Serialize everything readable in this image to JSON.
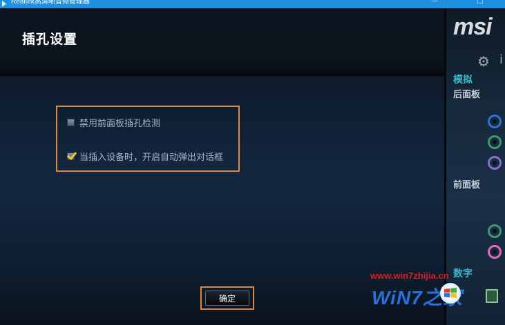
{
  "window": {
    "title": "Realtek高清晰音频管理器",
    "minimize_glyph": "—",
    "maximize_glyph": "□"
  },
  "dialog": {
    "title": "插孔设置",
    "options": [
      {
        "label": "禁用前面板插孔检测",
        "checked": false
      },
      {
        "label": "当插入设备时，开启自动弹出对话框",
        "checked": true
      }
    ],
    "ok_label": "确定"
  },
  "sidepanel": {
    "brand": "msi",
    "gear_glyph": "⚙",
    "info_glyph": "i",
    "analog_title": "模拟",
    "rear_panel": "后面板",
    "front_panel": "前面板",
    "digital_title": "数字",
    "rear_jacks": [
      "#2f6fd6",
      "#3c9a6e",
      "#8a6fc8"
    ],
    "front_jacks": [
      "#3c9a6e",
      "#e068b8"
    ]
  },
  "watermark": {
    "url": "www.win7zhijia.cn",
    "logo": "WiN7之家"
  },
  "colors": {
    "accent_highlight": "#e1883d",
    "title_bar": "#1f8fe0",
    "analog_heading": "#3fb6c9"
  }
}
